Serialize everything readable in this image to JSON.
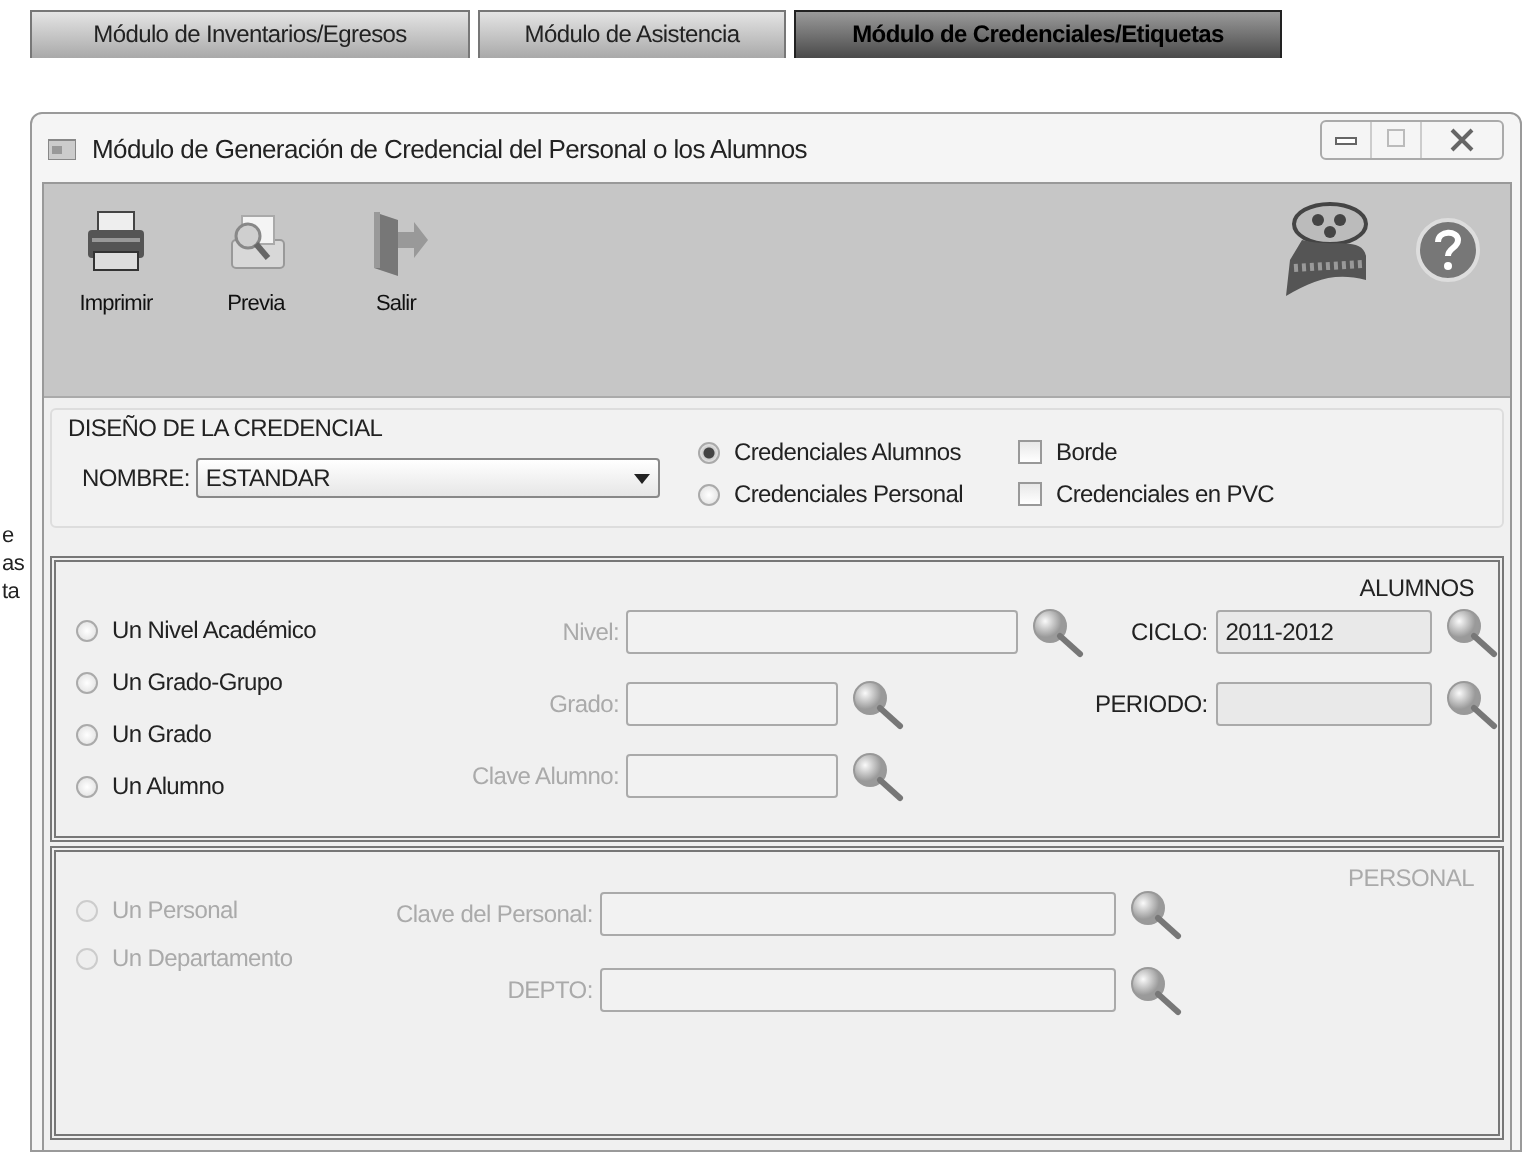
{
  "tabs": [
    {
      "label": "Módulo de Inventarios/Egresos",
      "selected": false
    },
    {
      "label": "Módulo de Asistencia",
      "selected": false
    },
    {
      "label": "Módulo de Credenciales/Etiquetas",
      "selected": true
    }
  ],
  "background_fragments": [
    "e",
    "as",
    "ta"
  ],
  "window": {
    "title": "Módulo de Generación de Credencial del Personal o los Alumnos"
  },
  "toolbar": {
    "buttons": [
      {
        "label": "Imprimir",
        "kind": "print"
      },
      {
        "label": "Previa",
        "kind": "preview"
      },
      {
        "label": "Salir",
        "kind": "exit"
      }
    ],
    "right_icons": [
      {
        "kind": "film"
      },
      {
        "kind": "help"
      }
    ]
  },
  "design": {
    "title": "DISEÑO DE LA CREDENCIAL",
    "name_label": "NOMBRE:",
    "name_value": "ESTANDAR",
    "types": [
      {
        "label": "Credenciales Alumnos",
        "selected": true
      },
      {
        "label": "Credenciales Personal",
        "selected": false
      }
    ],
    "options": [
      {
        "label": "Borde",
        "checked": false
      },
      {
        "label": "Credenciales en PVC",
        "checked": false
      }
    ]
  },
  "alumnos": {
    "title": "ALUMNOS",
    "disabled": false,
    "radios": [
      {
        "label": "Un Nivel Académico",
        "selected": false
      },
      {
        "label": "Un Grado-Grupo",
        "selected": false
      },
      {
        "label": "Un Grado",
        "selected": false
      },
      {
        "label": "Un Alumno",
        "selected": false
      }
    ],
    "fields": [
      {
        "label": "Nivel:",
        "kind": "wide",
        "disabled": true
      },
      {
        "label": "Grado:",
        "kind": "short",
        "disabled": true
      },
      {
        "label": "Clave Alumno:",
        "kind": "short",
        "disabled": true
      }
    ],
    "side_fields": [
      {
        "label": "CICLO:",
        "value": "2011-2012"
      },
      {
        "label": "PERIODO:"
      }
    ]
  },
  "personal": {
    "title": "PERSONAL",
    "disabled": true,
    "radios": [
      {
        "label": "Un Personal",
        "selected": false
      },
      {
        "label": "Un Departamento",
        "selected": false
      }
    ],
    "fields": [
      {
        "label": "Clave del Personal:",
        "kind": "wide",
        "disabled": true
      },
      {
        "label": "DEPTO:",
        "kind": "wide",
        "disabled": true
      }
    ]
  }
}
